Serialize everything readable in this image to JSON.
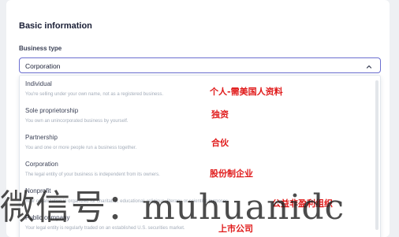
{
  "form": {
    "section_title": "Basic information",
    "business_type_label": "Business type",
    "selected_value": "Corporation"
  },
  "dropdown": {
    "options": [
      {
        "title": "Individual",
        "description": "You're selling under your own name, not as a registered business."
      },
      {
        "title": "Sole proprietorship",
        "description": "You own an unincorporated business by yourself."
      },
      {
        "title": "Partnership",
        "description": "You and one or more people run a business together."
      },
      {
        "title": "Corporation",
        "description": "The legal entity of your business is independent from its owners."
      },
      {
        "title": "Nonprofit",
        "description": "Your organization is organized for charitable, educational, religious, literary, or scientific purposes."
      },
      {
        "title": "Public company",
        "description": "Your legal entity is regularly traded on an established U.S. securities market."
      }
    ]
  },
  "annotations": [
    "个人-需美国人资料",
    "独资",
    "合伙",
    "股份制企业",
    "公益非盈利组织",
    "上市公司"
  ],
  "watermark": {
    "text": "微信号：muhuanidc"
  },
  "colors": {
    "focus_border": "#6b6fd0",
    "annotation_red": "#e01a1a"
  },
  "icons": {
    "select_chevron": "chevron-up-icon"
  }
}
